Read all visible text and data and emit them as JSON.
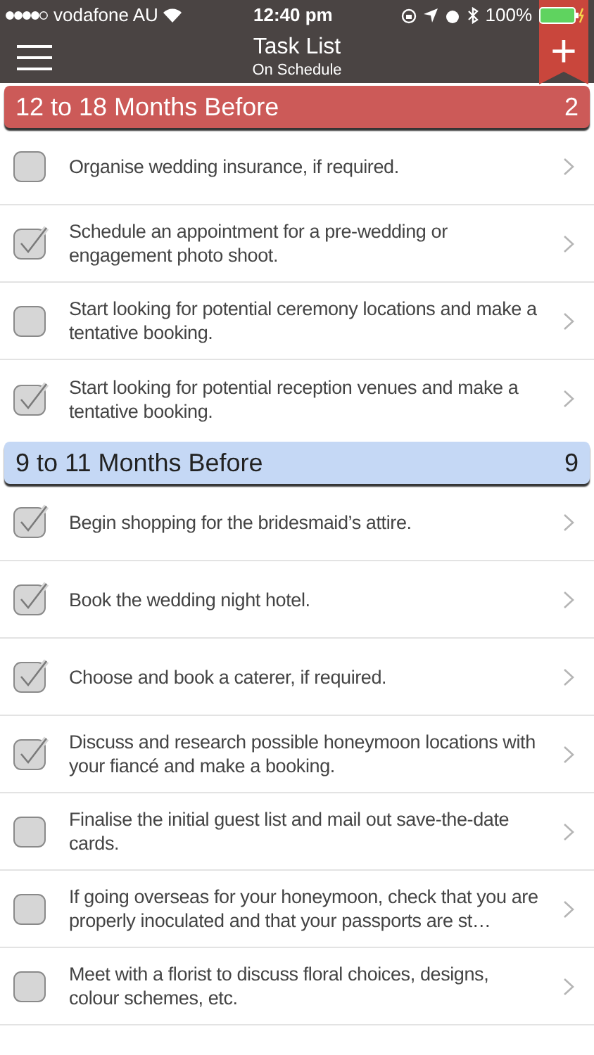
{
  "status_bar": {
    "carrier": "vodafone AU",
    "time": "12:40 pm",
    "battery": "100%"
  },
  "nav": {
    "title": "Task List",
    "subtitle": "On Schedule",
    "add": "+"
  },
  "sections": [
    {
      "title": "12 to 18 Months Before",
      "count": "2",
      "color": "#cc5a58",
      "tasks": [
        {
          "text": "Organise wedding insurance, if required.",
          "checked": false
        },
        {
          "text": "Schedule an appointment for a pre-wedding or engagement photo shoot.",
          "checked": true
        },
        {
          "text": "Start looking for potential ceremony locations and make a tentative booking.",
          "checked": false
        },
        {
          "text": "Start looking for potential reception venues and make a tentative booking.",
          "checked": true
        }
      ]
    },
    {
      "title": "9 to 11 Months Before",
      "count": "9",
      "color": "#c5d8f5",
      "tasks": [
        {
          "text": "Begin shopping for the bridesmaid’s attire.",
          "checked": true
        },
        {
          "text": "Book the wedding night hotel.",
          "checked": true
        },
        {
          "text": "Choose and book a caterer, if required.",
          "checked": true
        },
        {
          "text": "Discuss and research possible honeymoon locations with your fiancé and make a booking.",
          "checked": true
        },
        {
          "text": "Finalise the initial guest list and mail out save-the-date cards.",
          "checked": false
        },
        {
          "text": "If going overseas for your honeymoon, check that you are properly inoculated and that your passports are st…",
          "checked": false
        },
        {
          "text": "Meet with a florist to discuss floral choices, designs, colour schemes, etc.",
          "checked": false
        }
      ]
    }
  ]
}
